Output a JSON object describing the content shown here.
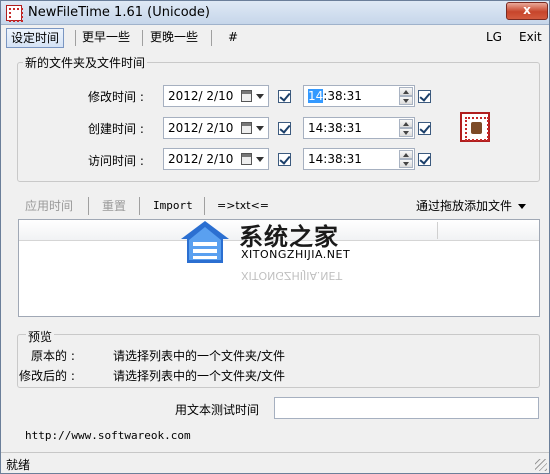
{
  "window": {
    "title": "NewFileTime 1.61 (Unicode)",
    "close_glyph": "x"
  },
  "menu": {
    "items": [
      "设定时间",
      "更早一些",
      "更晚一些",
      "#"
    ],
    "right": [
      "LG",
      "Exit"
    ]
  },
  "times_group": {
    "legend": "新的文件夹及文件时间",
    "rows": [
      {
        "label": "修改时间 :",
        "date": "2012/ 2/10",
        "time_hl": "14",
        "time_rest": ":38:31"
      },
      {
        "label": "创建时间 :",
        "date": "2012/ 2/10",
        "time_hl": "",
        "time_rest": "14:38:31"
      },
      {
        "label": "访问时间 :",
        "date": "2012/ 2/10",
        "time_hl": "",
        "time_rest": "14:38:31"
      }
    ]
  },
  "toolbar": {
    "apply": "应用时间",
    "reset": "重置",
    "import": "Import",
    "txt": "=>txt<=",
    "drag": "通过拖放添加文件"
  },
  "watermark": {
    "title": "系统之家",
    "subtitle": "XITONGZHIJIA.NET"
  },
  "preview": {
    "legend": "预览",
    "original_label": "原本的 :",
    "original_value": "请选择列表中的一个文件夹/文件",
    "modified_label": "修改后的 :",
    "modified_value": "请选择列表中的一个文件夹/文件"
  },
  "test": {
    "label": "用文本测试时间",
    "value": ""
  },
  "url": "http://www.softwareok.com",
  "status": "就绪"
}
